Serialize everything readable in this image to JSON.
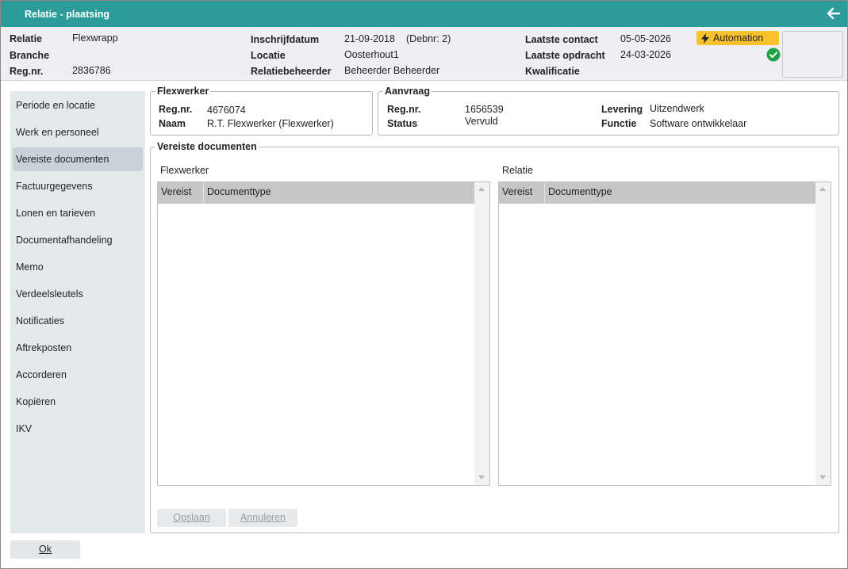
{
  "window": {
    "title": "Relatie - plaatsing",
    "back_icon": "arrow-left-icon"
  },
  "header": {
    "relatie_label": "Relatie",
    "relatie_value": "Flexwrapp",
    "branche_label": "Branche",
    "branche_value": "",
    "regnr_label": "Reg.nr.",
    "regnr_value": "2836786",
    "inschrijf_label": "Inschrijfdatum",
    "inschrijf_value": "21-09-2018",
    "debnr": "(Debnr: 2)",
    "locatie_label": "Locatie",
    "locatie_value": "Oosterhout1",
    "beheerder_label": "Relatiebeheerder",
    "beheerder_value": "Beheerder Beheerder",
    "contact_label": "Laatste contact",
    "contact_value": "05-05-2026",
    "opdracht_label": "Laatste opdracht",
    "opdracht_value": "24-03-2026",
    "kwalificatie_label": "Kwalificatie",
    "kwalificatie_value": "",
    "badge_label": "Automation",
    "badge_color": "#f8c12e",
    "status_color": "#23a046"
  },
  "sidebar": {
    "items": [
      {
        "label": "Periode en locatie",
        "active": false
      },
      {
        "label": "Werk en personeel",
        "active": false
      },
      {
        "label": "Vereiste documenten",
        "active": true
      },
      {
        "label": "Factuurgegevens",
        "active": false
      },
      {
        "label": "Lonen en tarieven",
        "active": false
      },
      {
        "label": "Documentafhandeling",
        "active": false
      },
      {
        "label": "Memo",
        "active": false
      },
      {
        "label": "Verdeelsleutels",
        "active": false
      },
      {
        "label": "Notificaties",
        "active": false
      },
      {
        "label": "Aftrekposten",
        "active": false
      },
      {
        "label": "Accorderen",
        "active": false
      },
      {
        "label": "Kopiëren",
        "active": false
      },
      {
        "label": "IKV",
        "active": false
      }
    ]
  },
  "flexwerker": {
    "legend": "Flexwerker",
    "regnr_label": "Reg.nr.",
    "regnr_value": "4676074",
    "naam_label": "Naam",
    "naam_value": "R.T. Flexwerker (Flexwerker)"
  },
  "aanvraag": {
    "legend": "Aanvraag",
    "regnr_label": "Reg.nr.",
    "regnr_value": "1656539",
    "status_label": "Status",
    "status_value": "Vervuld",
    "levering_label": "Levering",
    "levering_value": "Uitzendwerk",
    "functie_label": "Functie",
    "functie_value": "Software ontwikkelaar"
  },
  "documents": {
    "legend": "Vereiste documenten",
    "flex_title": "Flexwerker",
    "rel_title": "Relatie",
    "col_vereist": "Vereist",
    "col_type": "Documenttype"
  },
  "buttons": {
    "save": "Opslaan",
    "cancel": "Annuleren",
    "ok": "Ok"
  }
}
